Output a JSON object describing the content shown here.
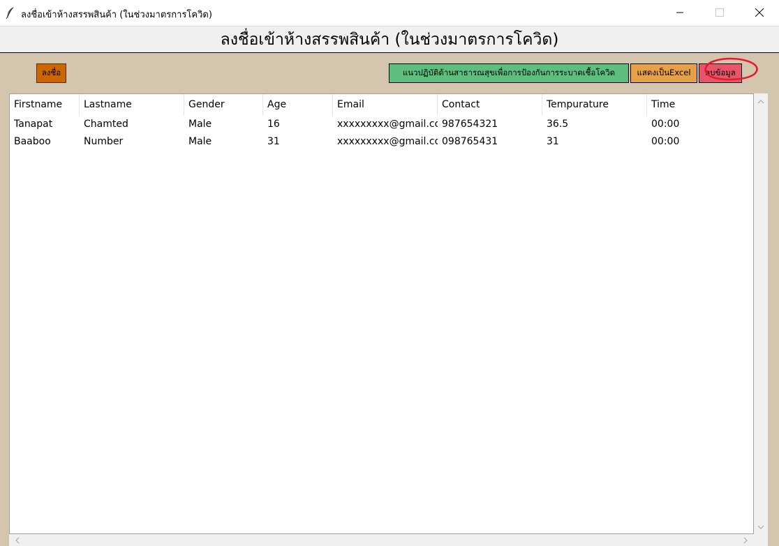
{
  "window": {
    "title": "ลงชื่อเข้าห้างสรรพสินค้า (ในช่วงมาตรการโควิด)",
    "icon": "feather-icon"
  },
  "header": {
    "title": "ลงชื่อเข้าห้างสรรพสินค้า (ในช่วงมาตรการโควิด)"
  },
  "toolbar": {
    "register_label": "ลงชื่อ",
    "guidelines_label": "แนวปฏิบัติด้านสาธารณสุขเพื่อการป้องกันการระบาดเชื้อโควิด",
    "excel_label": "แสดงเป็นExcel",
    "delete_label": "ลบข้อมูล"
  },
  "colors": {
    "background": "#d4c5ae",
    "register_button": "#cc6600",
    "guidelines_button": "#5dbe7e",
    "excel_button": "#e7a04a",
    "delete_button": "#e7556a",
    "annotation": "#e8192c"
  },
  "table": {
    "columns": [
      "Firstname",
      "Lastname",
      "Gender",
      "Age",
      "Email",
      "Contact",
      "Tempurature",
      "Time"
    ],
    "rows": [
      [
        "Tanapat",
        "Chamted",
        "Male",
        "16",
        "xxxxxxxxx@gmail.com",
        "987654321",
        "36.5",
        "00:00"
      ],
      [
        "Baaboo",
        "Number",
        "Male",
        "31",
        "xxxxxxxxx@gmail.com",
        "098765431",
        "31",
        "00:00"
      ]
    ]
  }
}
